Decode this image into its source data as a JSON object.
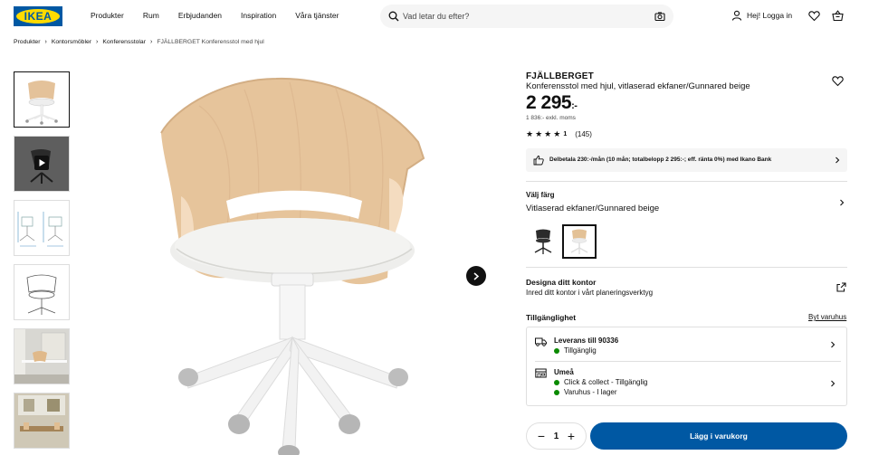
{
  "brand": {
    "logo_text": "IKEA",
    "blue": "#0058a3",
    "yellow": "#ffdb00"
  },
  "nav": [
    "Produkter",
    "Rum",
    "Erbjudanden",
    "Inspiration",
    "Våra tjänster"
  ],
  "search": {
    "placeholder": "Vad letar du efter?"
  },
  "header": {
    "login_label": "Hej! Logga in"
  },
  "breadcrumb": [
    "Produkter",
    "Kontorsmöbler",
    "Konferensstolar",
    "FJÄLLBERGET Konferensstol med hjul"
  ],
  "gallery": {
    "thumbnails": [
      "chair-front-photo",
      "video-thumbnail",
      "measurement-drawing",
      "line-drawing",
      "room-photo-desk",
      "room-photo-conference"
    ],
    "main_image": "fjallberget-chair-photo"
  },
  "product": {
    "name": "FJÄLLBERGET",
    "description": "Konferensstol med hjul, vitlaserad ekfaner/Gunnared beige",
    "price": "2 295",
    "price_suffix": ":-",
    "price_ex_vat": "1 836:- exkl. moms",
    "rating_value": "1",
    "rating_count": "(145)",
    "stars": 4.5,
    "financing": "Delbetala 230:-/mån (10 mån; totalbelopp 2 295:-; eff. ränta 0%) med Ikano Bank"
  },
  "color": {
    "label": "Välj färg",
    "value": "Vitlaserad ekfaner/Gunnared beige",
    "swatches": [
      "black-chair",
      "oak-beige-chair"
    ],
    "selected_index": 1
  },
  "design": {
    "title": "Designa ditt kontor",
    "subtitle": "Inred ditt kontor i vårt planeringsverktyg"
  },
  "availability": {
    "title": "Tillgänglighet",
    "change_store": "Byt varuhus",
    "delivery": {
      "title": "Leverans till 90336",
      "status": "Tillgänglig"
    },
    "store": {
      "title": "Umeå",
      "line1": "Click & collect - Tillgänglig",
      "line2": "Varuhus - I lager"
    },
    "status_color": "#0a8a00"
  },
  "cart": {
    "quantity": "1",
    "minus": "−",
    "plus": "+",
    "add_label": "Lägg i varukorg"
  }
}
